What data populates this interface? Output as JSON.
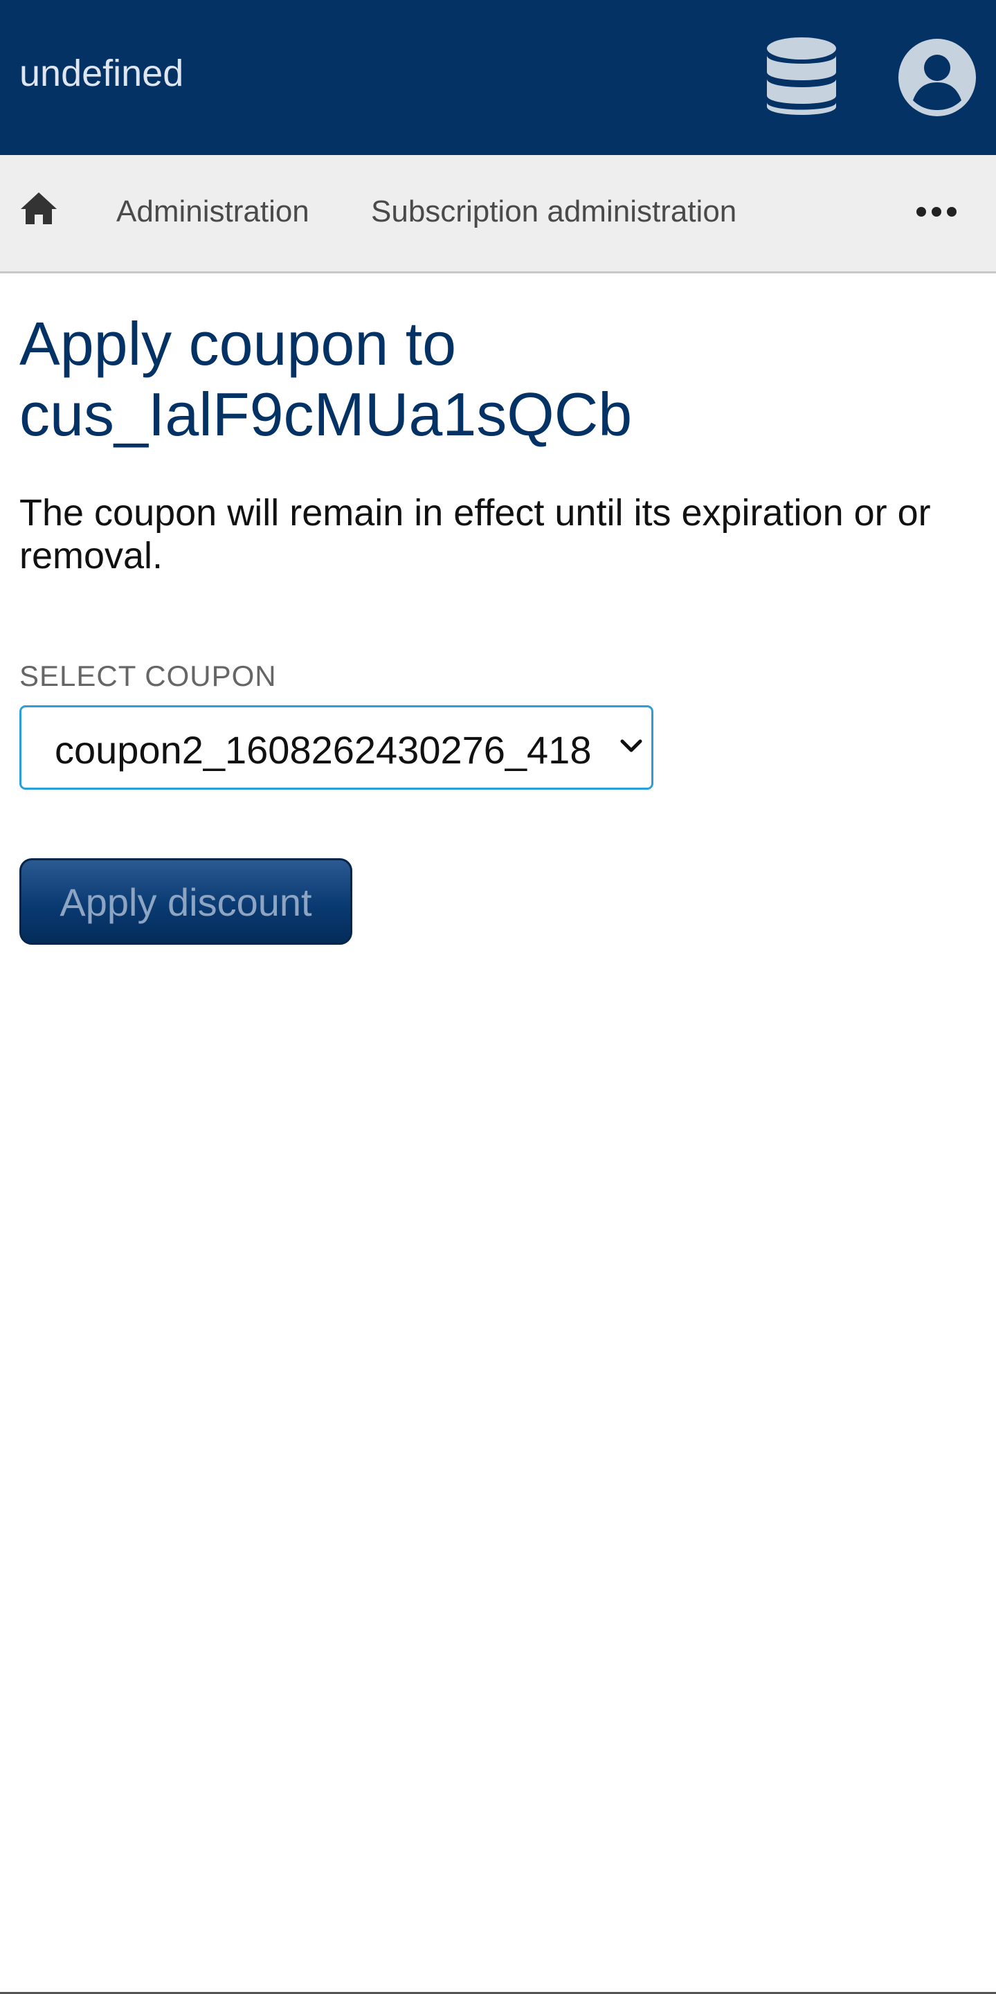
{
  "app": {
    "title": "undefined"
  },
  "header": {
    "database_icon": "database-icon",
    "account_icon": "user-circle-icon"
  },
  "nav": {
    "home_icon": "home-icon",
    "links": [
      {
        "label": "Administration"
      },
      {
        "label": "Subscription administration"
      }
    ],
    "more_icon": "ellipsis-icon"
  },
  "page": {
    "title": "Apply coupon to cus_IalF9cMUa1sQCb",
    "description": "The coupon will remain in effect until its expiration or or removal."
  },
  "form": {
    "coupon_label": "SELECT COUPON",
    "coupon_selected": "coupon2_1608262430276_418",
    "submit_label": "Apply discount"
  },
  "colors": {
    "header_bg": "#043264",
    "nav_bg": "#eeeeee",
    "title": "#043264",
    "select_border": "#2a9fd8",
    "button_bg": "#0a3a72"
  }
}
